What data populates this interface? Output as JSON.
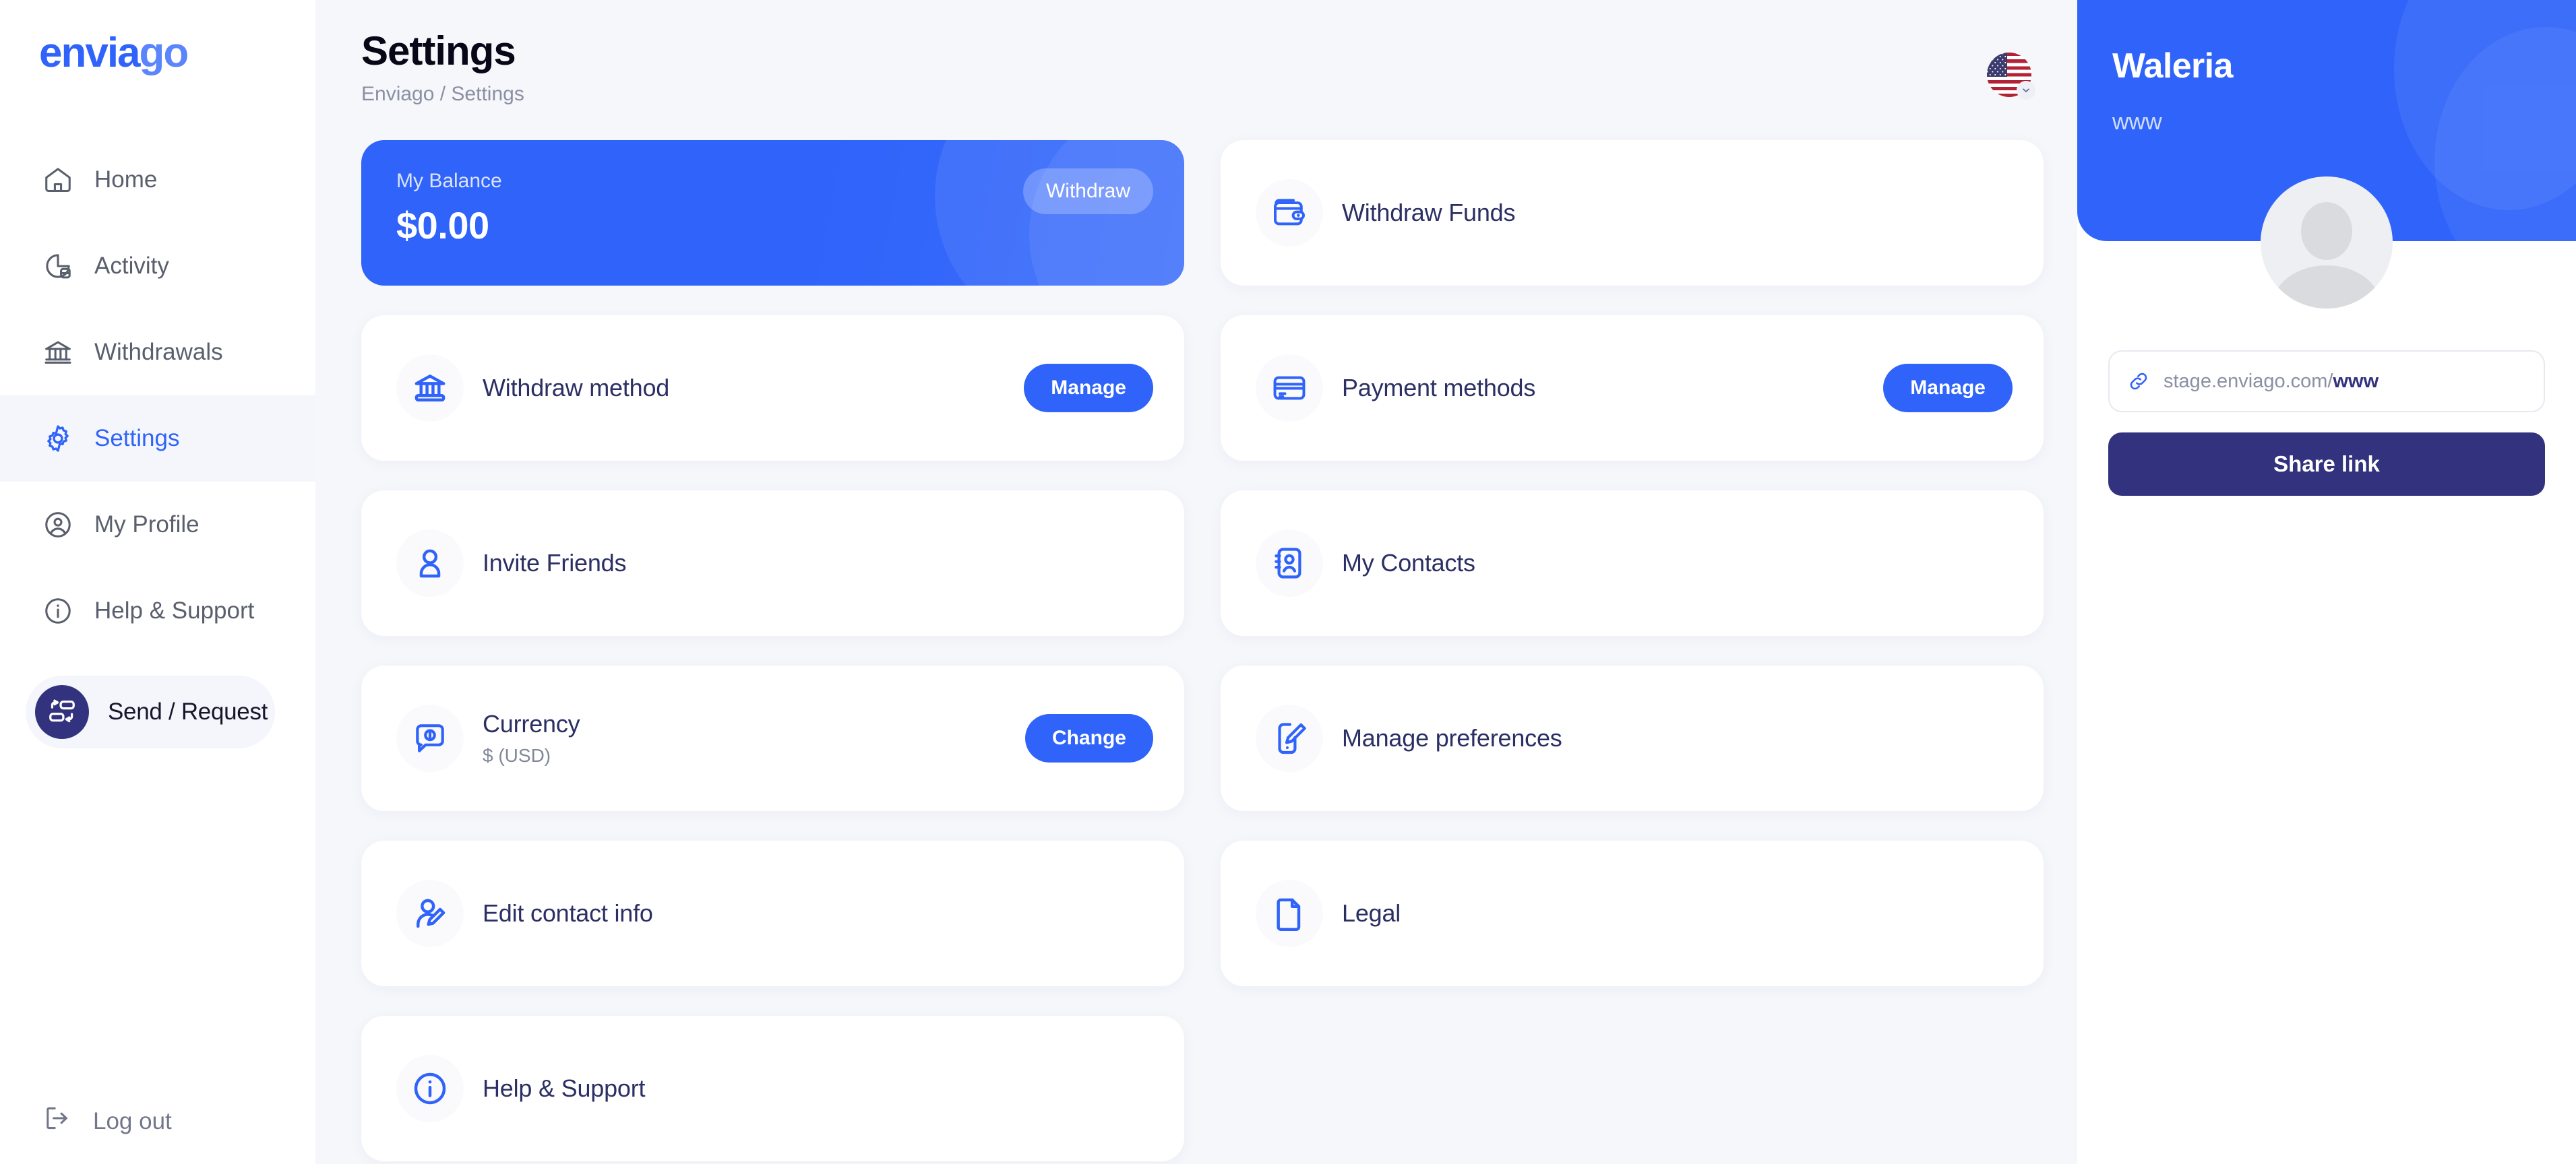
{
  "brand": {
    "logo_part_a": "envia",
    "logo_part_b": "go",
    "accent_color": "#2f63fa",
    "accent_dark_color": "#32327e",
    "text_dark_color": "#2b2f63"
  },
  "sidebar": {
    "items": [
      {
        "label": "Home",
        "icon": "home-icon",
        "active": false
      },
      {
        "label": "Activity",
        "icon": "activity-icon",
        "active": false
      },
      {
        "label": "Withdrawals",
        "icon": "bank-icon",
        "active": false
      },
      {
        "label": "Settings",
        "icon": "gear-icon",
        "active": true
      },
      {
        "label": "My Profile",
        "icon": "user-circle-icon",
        "active": false
      },
      {
        "label": "Help & Support",
        "icon": "info-circle-icon",
        "active": false
      }
    ],
    "send_request_label": "Send / Request",
    "logout_label": "Log out"
  },
  "header": {
    "title": "Settings",
    "breadcrumb": "Enviago / Settings",
    "language_flag": "us-flag-icon"
  },
  "balance": {
    "label": "My Balance",
    "amount": "$0.00",
    "withdraw_label": "Withdraw"
  },
  "settings_cards": {
    "left": [
      {
        "title": "Withdraw method",
        "subtitle": "",
        "icon": "bank-icon",
        "action": "Manage"
      },
      {
        "title": "Invite Friends",
        "subtitle": "",
        "icon": "user-add-icon",
        "action": ""
      },
      {
        "title": "Currency",
        "subtitle": "$ (USD)",
        "icon": "currency-chat-icon",
        "action": "Change"
      },
      {
        "title": "Edit contact info",
        "subtitle": "",
        "icon": "user-edit-icon",
        "action": ""
      },
      {
        "title": "Help & Support",
        "subtitle": "",
        "icon": "info-circle-icon",
        "action": ""
      }
    ],
    "right": [
      {
        "title": "Withdraw Funds",
        "subtitle": "",
        "icon": "wallet-icon",
        "action": ""
      },
      {
        "title": "Payment methods",
        "subtitle": "",
        "icon": "credit-card-icon",
        "action": "Manage"
      },
      {
        "title": "My Contacts",
        "subtitle": "",
        "icon": "contact-book-icon",
        "action": ""
      },
      {
        "title": "Manage preferences",
        "subtitle": "",
        "icon": "phone-edit-icon",
        "action": ""
      },
      {
        "title": "Legal",
        "subtitle": "",
        "icon": "document-icon",
        "action": ""
      }
    ]
  },
  "profile": {
    "name": "Waleria",
    "handle": "www",
    "link_prefix": "stage.enviago.com/",
    "link_handle": "www",
    "share_label": "Share link",
    "link_icon": "link-icon"
  }
}
